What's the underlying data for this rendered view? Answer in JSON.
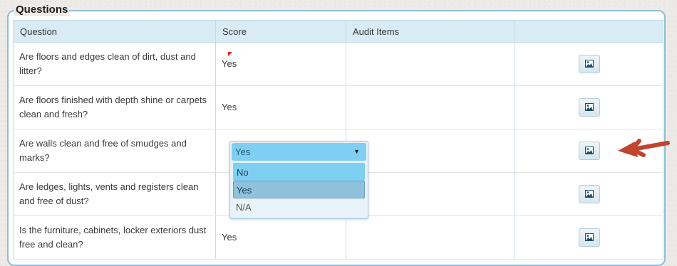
{
  "section": {
    "legend": "Questions"
  },
  "table": {
    "headers": [
      "Question",
      "Score",
      "Audit Items",
      ""
    ],
    "rows": [
      {
        "question": "Are floors and edges clean of dirt, dust and litter?",
        "score": "Yes"
      },
      {
        "question": "Are floors finished with depth shine or carpets clean and fresh?",
        "score": "Yes"
      },
      {
        "question": "Are walls clean and free of smudges and marks?",
        "score": ""
      },
      {
        "question": "Are ledges, lights, vents and registers clean and free of dust?",
        "score": ""
      },
      {
        "question": "Is the furniture, cabinets, locker exteriors dust free and clean?",
        "score": "Yes"
      }
    ]
  },
  "dropdown": {
    "selected": "Yes",
    "caret": "▼",
    "options": [
      "No",
      "Yes",
      "N/A"
    ]
  },
  "icons": {
    "image_button": "image-icon",
    "annotation": "red-arrow-icon"
  },
  "colors": {
    "header_bg": "#d9ebf5",
    "dropdown_highlight": "#7ecff2",
    "arrow": "#c0442f",
    "flag": "#e02020"
  }
}
